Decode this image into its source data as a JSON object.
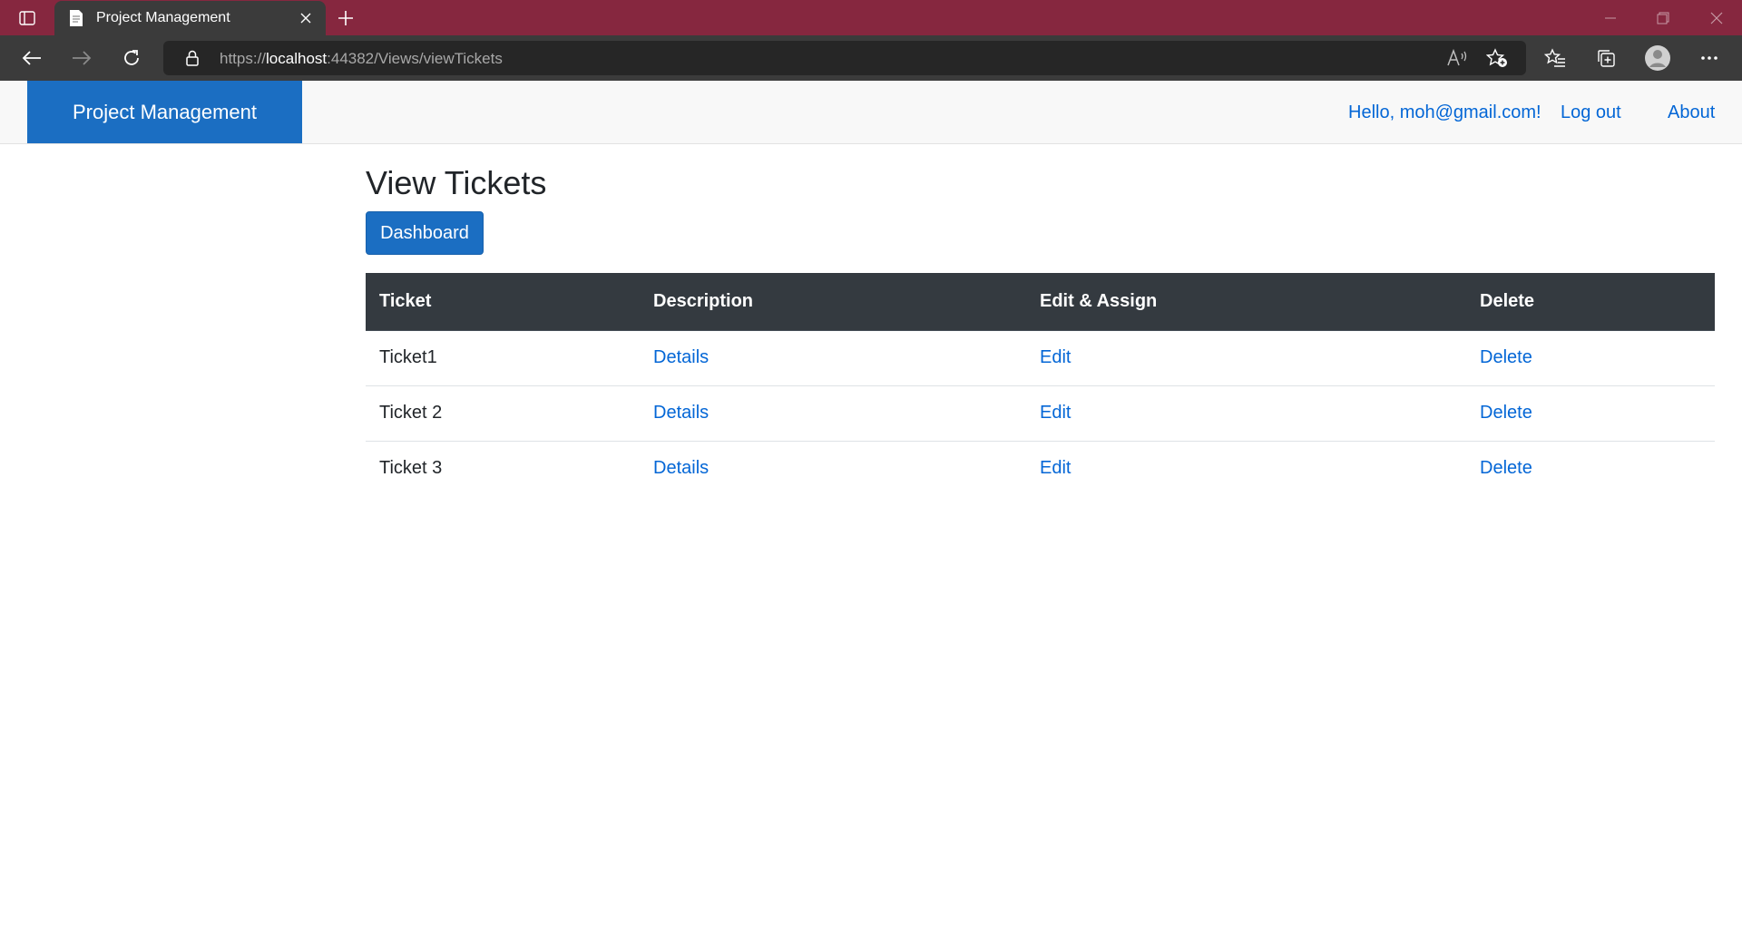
{
  "browser": {
    "tab_title": "Project Management",
    "url_scheme": "https://",
    "url_host": "localhost",
    "url_rest": ":44382/Views/viewTickets",
    "titlebar_color": "#86273f"
  },
  "navbar": {
    "brand": "Project Management",
    "greeting": "Hello, moh@gmail.com!",
    "logout": "Log out",
    "about": "About"
  },
  "main": {
    "title": "View Tickets",
    "dashboard_button": "Dashboard",
    "table": {
      "headers": [
        "Ticket",
        "Description",
        "Edit & Assign",
        "Delete"
      ],
      "rows": [
        {
          "ticket": "Ticket1",
          "description": "Details",
          "edit": "Edit",
          "delete": "Delete"
        },
        {
          "ticket": "Ticket 2",
          "description": "Details",
          "edit": "Edit",
          "delete": "Delete"
        },
        {
          "ticket": "Ticket 3",
          "description": "Details",
          "edit": "Edit",
          "delete": "Delete"
        }
      ]
    }
  },
  "colors": {
    "accent": "#1b6ec2",
    "link": "#0366d6",
    "table_header": "#343a40"
  }
}
